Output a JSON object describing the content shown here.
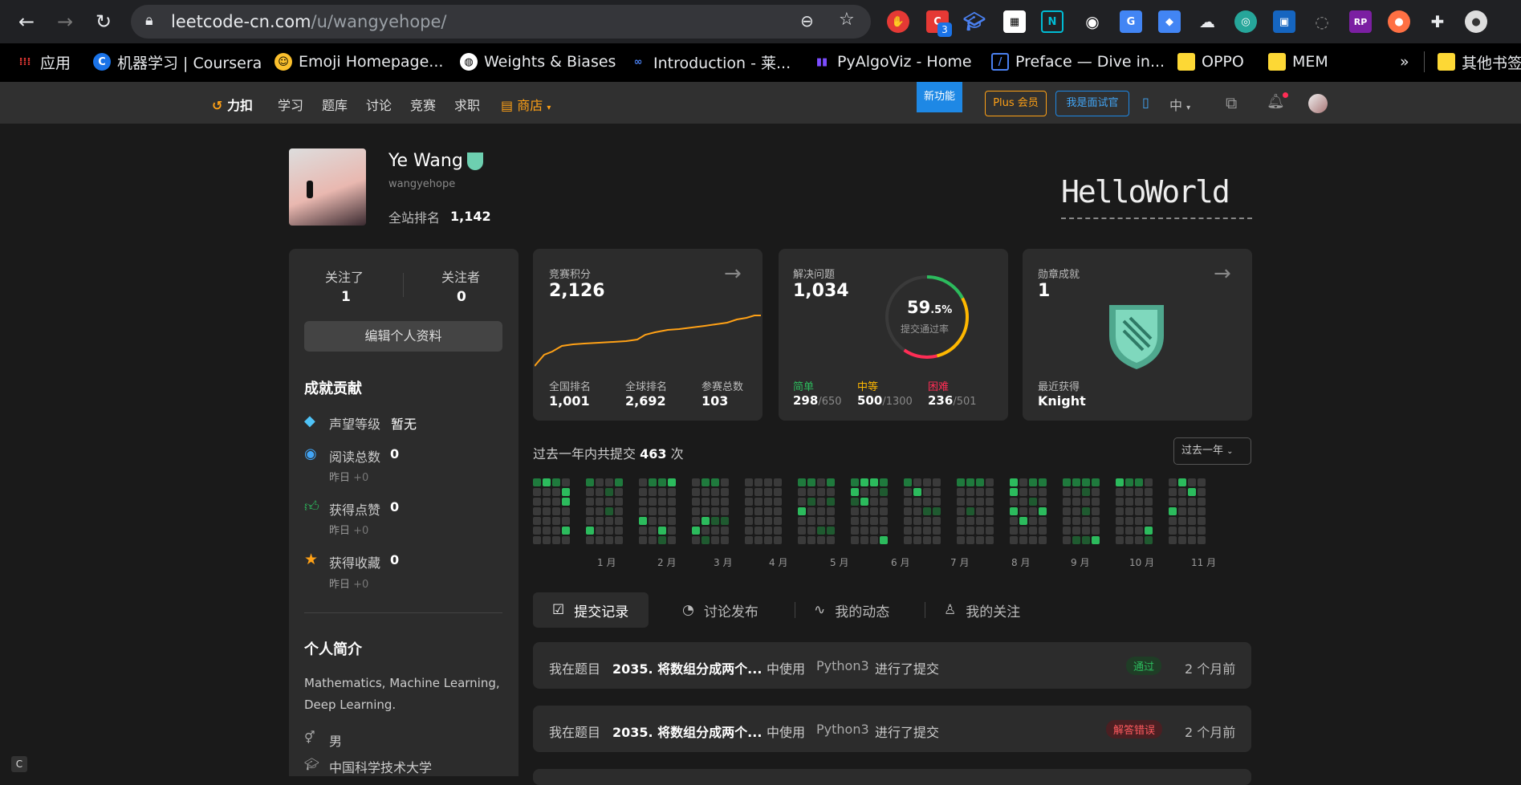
{
  "browser": {
    "url_host": "leetcode-cn.com",
    "url_path": "/u/wangyehope/",
    "extension_badge": "3",
    "bookmarks": [
      {
        "label": "应用"
      },
      {
        "label": "机器学习 | Coursera"
      },
      {
        "label": "Emoji Homepage..."
      },
      {
        "label": "Weights & Biases"
      },
      {
        "label": "Introduction - 莱..."
      },
      {
        "label": "PyAlgoViz - Home"
      },
      {
        "label": "Preface — Dive in..."
      },
      {
        "label": "OPPO"
      },
      {
        "label": "MEM"
      },
      {
        "label": "其他书签"
      }
    ],
    "more_label": "»"
  },
  "site": {
    "logo": "力扣",
    "nav": [
      "学习",
      "题库",
      "讨论",
      "竞赛",
      "求职"
    ],
    "store": "商店",
    "new_feature": "新功能",
    "plus": "Plus 会员",
    "interviewer": "我是面试官",
    "lang": "中"
  },
  "profile": {
    "name": "Ye Wang",
    "handle": "wangyehope",
    "rank_label": "全站排名",
    "rank_value": "1,142",
    "banner_text": "HelloWorld"
  },
  "left": {
    "following_label": "关注了",
    "following": "1",
    "followers_label": "关注者",
    "followers": "0",
    "edit_button": "编辑个人资料",
    "achievements_title": "成就贡献",
    "reputation_label": "声望等级",
    "reputation_value": "暂无",
    "reads_label": "阅读总数",
    "reads_value": "0",
    "reads_sub": "昨日",
    "reads_delta": "+0",
    "likes_label": "获得点赞",
    "likes_value": "0",
    "likes_sub": "昨日",
    "likes_delta": "+0",
    "favs_label": "获得收藏",
    "favs_value": "0",
    "favs_sub": "昨日",
    "favs_delta": "+0",
    "intro_title": "个人简介",
    "intro_text": "Mathematics, Machine Learning, Deep Learning.",
    "gender": "男",
    "school": "中国科学技术大学"
  },
  "contest": {
    "label": "竞赛积分",
    "score": "2,126",
    "national_label": "全国排名",
    "national": "1,001",
    "global_label": "全球排名",
    "global": "2,692",
    "count_label": "参赛总数",
    "count": "103"
  },
  "solved": {
    "label": "解决问题",
    "total": "1,034",
    "rate_main": "59",
    "rate_dec": ".5%",
    "rate_label": "提交通过率",
    "rate": 0.595,
    "easy_label": "简单",
    "easy": "298",
    "easy_total": "/650",
    "medium_label": "中等",
    "medium": "500",
    "medium_total": "/1300",
    "hard_label": "困难",
    "hard": "236",
    "hard_total": "/501"
  },
  "badges": {
    "label": "勋章成就",
    "count": "1",
    "recent_label": "最近获得",
    "recent": "Knight"
  },
  "heatmap": {
    "summary_prefix": "过去一年内共提交",
    "summary_count": "463",
    "summary_suffix": "次",
    "range": "过去一年",
    "months": [
      "1 月",
      "2 月",
      "3 月",
      "4 月",
      "5 月",
      "6 月",
      "7 月",
      "8 月",
      "9 月",
      "10 月",
      "11 月"
    ]
  },
  "tabs": [
    "提交记录",
    "讨论发布",
    "我的动态",
    "我的关注"
  ],
  "submissions": [
    {
      "prefix": "我在题目",
      "title": "2035. 将数组分成两个...",
      "mid": "中使用",
      "lang": "Python3",
      "suffix": "进行了提交",
      "status": "通过",
      "time": "2 个月前"
    },
    {
      "prefix": "我在题目",
      "title": "2035. 将数组分成两个...",
      "mid": "中使用",
      "lang": "Python3",
      "suffix": "进行了提交",
      "status": "解答错误",
      "time": "2 个月前"
    }
  ],
  "colors": {
    "accent": "#ffa116",
    "easy": "#00af9b",
    "medium": "#ffb800",
    "hard": "#ff2d55",
    "green": "#2cbb5d"
  }
}
